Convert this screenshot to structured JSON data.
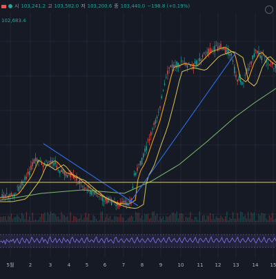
{
  "legend": {
    "open_label": "시",
    "open_value": "103,241.2",
    "high_label": "고",
    "high_value": "103,582.0",
    "low_label": "저",
    "low_value": "103,200.6",
    "close_label": "종",
    "close_value": "103,440.0",
    "change_value": "−198.8 (+0.19%)",
    "ma_value": "102,683.4"
  },
  "colors": {
    "background": "#161a25",
    "grid": "#232733",
    "up": "#26a69a",
    "down": "#ef5350",
    "ma_fast": "#f0a020",
    "ma_mid": "#d9c65a",
    "ma_slow": "#7fbf6a",
    "trendline": "#2f6ee8",
    "support": "#e6d24a",
    "rsi": "#7b6fe0"
  },
  "chart_data": {
    "type": "candlestick",
    "x_ticks": [
      "5월",
      "2",
      "3",
      "4",
      "5",
      "6",
      "7",
      "8",
      "9",
      "10",
      "11",
      "12",
      "13",
      "14",
      "15"
    ],
    "indicator": "RSI",
    "indicator_ylim": [
      0,
      100
    ],
    "indicator_band": [
      30,
      70
    ],
    "indicator_points": [
      48,
      50,
      45,
      52,
      41,
      55,
      50,
      46,
      53,
      49,
      56,
      44,
      51,
      58,
      47,
      42,
      55,
      60,
      48,
      45,
      57,
      52,
      43,
      49,
      62,
      55,
      46,
      52,
      58,
      50,
      44,
      53,
      61,
      47,
      55,
      50,
      42,
      56,
      63,
      49,
      46,
      54,
      59,
      45,
      51,
      57,
      48,
      44,
      60,
      53,
      47,
      55,
      50,
      43,
      58,
      62,
      49,
      46,
      56,
      51,
      45,
      53,
      59,
      48,
      44,
      55,
      61,
      50,
      47,
      54,
      52,
      46,
      57,
      63,
      49,
      45,
      53,
      58,
      50,
      44,
      56,
      60,
      47,
      51,
      55,
      48,
      43,
      59,
      62,
      50,
      46,
      54,
      57,
      49,
      45,
      52,
      58,
      51,
      47,
      56,
      60,
      48,
      44,
      53,
      62,
      50,
      46,
      55,
      57,
      49,
      45,
      52,
      59,
      51,
      47,
      55,
      61,
      48,
      44,
      54,
      58,
      50,
      46,
      53,
      60,
      49,
      45,
      56,
      62,
      51,
      47,
      54,
      58,
      50,
      46,
      52,
      60,
      49,
      45,
      55,
      61,
      51,
      47,
      53,
      59,
      50,
      46,
      54,
      62,
      48,
      44,
      56,
      58,
      51,
      47,
      53,
      60,
      50,
      45,
      55,
      63,
      49,
      46,
      54,
      58,
      51,
      47,
      52,
      61,
      50,
      44,
      56,
      59,
      48,
      46,
      53,
      60,
      51,
      47,
      55,
      62,
      49,
      45,
      54,
      58,
      50,
      46,
      52,
      61,
      51,
      47,
      55,
      59,
      48,
      44,
      53,
      60,
      50,
      46,
      54,
      62,
      49,
      45,
      56,
      58,
      51,
      47,
      53,
      60,
      50
    ]
  }
}
